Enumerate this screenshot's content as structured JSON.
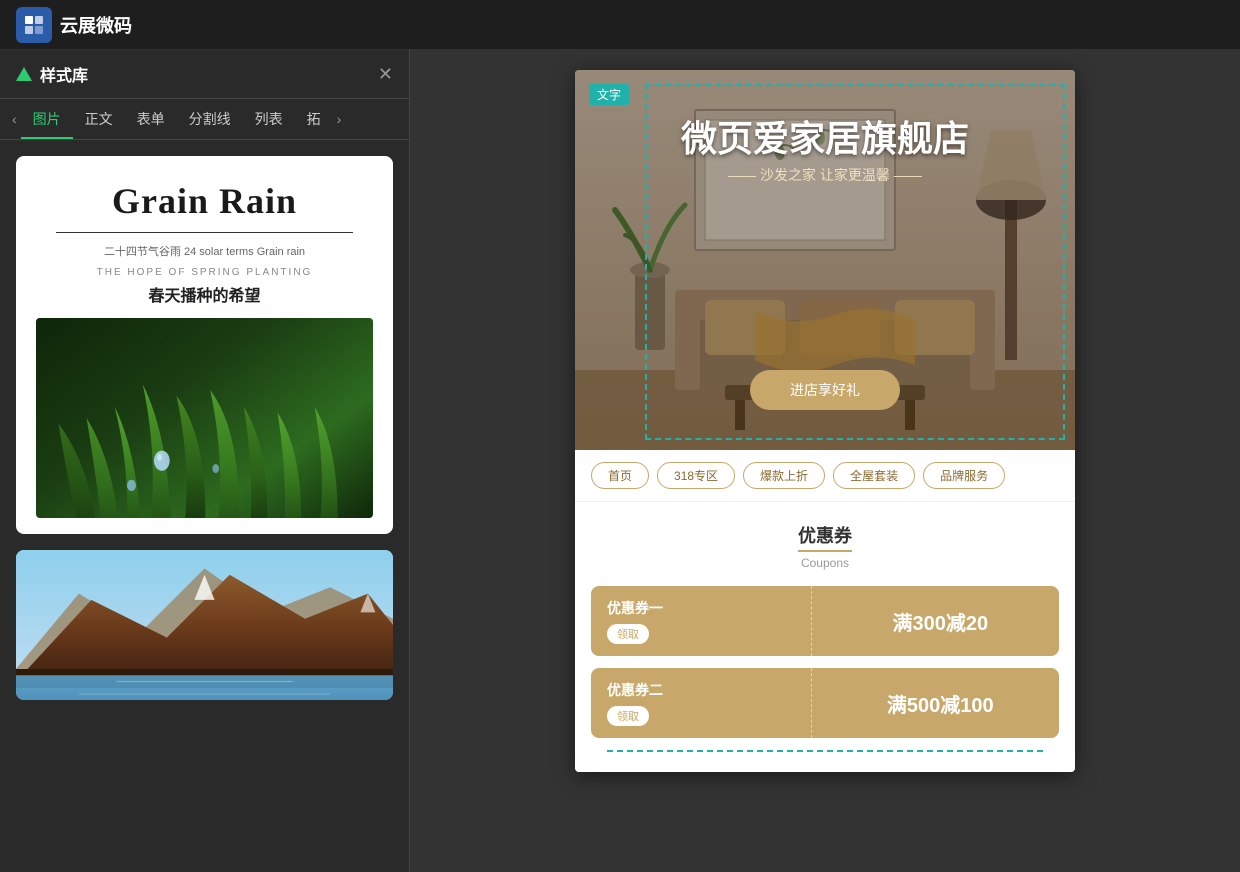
{
  "app": {
    "logo_text": "云展微码",
    "logo_icon": "☷"
  },
  "panel": {
    "title": "样式库",
    "close_btn": "✕",
    "tabs": [
      {
        "label": "图片",
        "active": true
      },
      {
        "label": "正文",
        "active": false
      },
      {
        "label": "表单",
        "active": false
      },
      {
        "label": "分割线",
        "active": false
      },
      {
        "label": "列表",
        "active": false
      },
      {
        "label": "拓",
        "active": false
      }
    ],
    "left_arrow": "‹",
    "right_arrow": "›"
  },
  "style_card_1": {
    "title": "Grain Rain",
    "subtitle": "二十四节气谷雨 24  solar terms Grain rain",
    "hope_en": "THE HOPE OF SPRING PLANTING",
    "hope_cn": "春天播种的希望"
  },
  "preview": {
    "right_panel_bg": "#333333"
  },
  "mobile": {
    "text_badge": "文字",
    "hero_title": "微页爱家居旗舰店",
    "hero_subtitle": "—— 沙发之家 让家更温馨 ——",
    "hero_btn": "进店享好礼",
    "nav_tabs": [
      "首页",
      "318专区",
      "爆款上折",
      "全屋套装",
      "品牌服务"
    ],
    "coupon_section": {
      "heading": "优惠券",
      "sub": "Coupons",
      "cards": [
        {
          "name": "优惠券一",
          "receive": "领取",
          "amount": "满300减20"
        },
        {
          "name": "优惠券二",
          "receive": "领取",
          "amount": "满500减100"
        }
      ]
    }
  }
}
